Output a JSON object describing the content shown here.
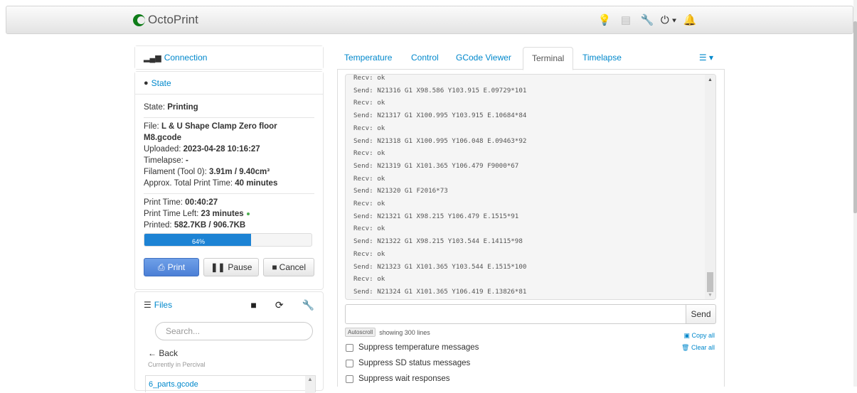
{
  "navbar": {
    "brand": "OctoPrint",
    "icons": [
      "lightbulb-icon",
      "clipboard-icon",
      "wrench-icon",
      "power-icon",
      "bell-icon"
    ]
  },
  "sidebar": {
    "connection_label": "Connection",
    "state_label": "State",
    "state": {
      "state_key": "State:",
      "state_value": "Printing",
      "file_key": "File:",
      "file_value": "L & U Shape Clamp Zero floor M8.gcode",
      "uploaded_key": "Uploaded:",
      "uploaded_value": "2023-04-28 10:16:27",
      "timelapse_key": "Timelapse:",
      "timelapse_value": "-",
      "filament_key": "Filament (Tool 0):",
      "filament_value": "3.91m / 9.40cm³",
      "approx_key": "Approx. Total Print Time:",
      "approx_value": "40 minutes",
      "print_time_key": "Print Time:",
      "print_time_value": "00:40:27",
      "time_left_key": "Print Time Left:",
      "time_left_value": "23 minutes",
      "printed_key": "Printed:",
      "printed_value": "582.7KB / 906.7KB",
      "progress_label": "64%",
      "progress_fraction": 0.64
    },
    "buttons": {
      "print": "Print",
      "pause": "Pause",
      "cancel": "Cancel"
    },
    "files": {
      "label": "Files",
      "search_placeholder": "Search...",
      "back": "← Back",
      "current_folder": "Currently in Percival",
      "first_item": "6_parts.gcode"
    }
  },
  "tabs": [
    "Temperature",
    "Control",
    "GCode Viewer",
    "Terminal",
    "Timelapse"
  ],
  "active_tab": "Terminal",
  "terminal": {
    "lines": [
      "Recv: ok",
      "Send: N21316 G1 X98.586 Y103.915 E.09729*101",
      "Recv: ok",
      "Send: N21317 G1 X100.995 Y103.915 E.10684*84",
      "Recv: ok",
      "Send: N21318 G1 X100.995 Y106.048 E.09463*92",
      "Recv: ok",
      "Send: N21319 G1 X101.365 Y106.479 F9000*67",
      "Recv: ok",
      "Send: N21320 G1 F2016*73",
      "Recv: ok",
      "Send: N21321 G1 X98.215 Y106.479 E.1515*91",
      "Recv: ok",
      "Send: N21322 G1 X98.215 Y103.544 E.14115*98",
      "Recv: ok",
      "Send: N21323 G1 X101.365 Y103.544 E.1515*100",
      "Recv: ok",
      "Send: N21324 G1 X101.365 Y106.419 E.13826*81"
    ],
    "send_label": "Send",
    "autoscroll_label": "Autoscroll",
    "showing_label": "showing 300 lines",
    "copy_all": "Copy all",
    "clear_all": "Clear all",
    "options": [
      "Suppress temperature messages",
      "Suppress SD status messages",
      "Suppress wait responses"
    ]
  }
}
